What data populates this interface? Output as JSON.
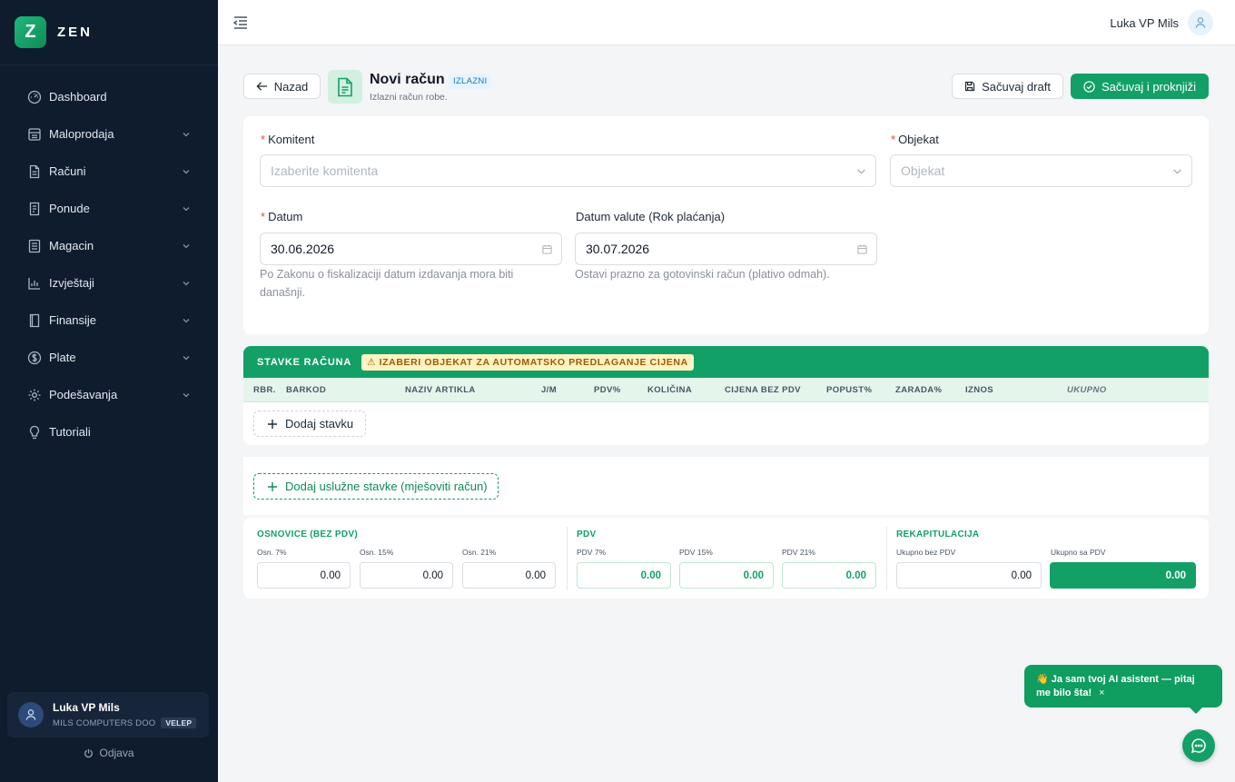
{
  "brand": {
    "logo_letter": "Z",
    "name": "ZEN",
    "accent": "#12a067",
    "sidebar_bg": "#0f1c2e"
  },
  "sidebar": {
    "items": [
      {
        "label": "Dashboard",
        "icon": "dashboard-icon",
        "expandable": false
      },
      {
        "label": "Maloprodaja",
        "icon": "register-icon",
        "expandable": true
      },
      {
        "label": "Računi",
        "icon": "document-icon",
        "expandable": true
      },
      {
        "label": "Ponude",
        "icon": "offer-icon",
        "expandable": true
      },
      {
        "label": "Magacin",
        "icon": "warehouse-icon",
        "expandable": true
      },
      {
        "label": "Izvještaji",
        "icon": "chart-icon",
        "expandable": true
      },
      {
        "label": "Finansije",
        "icon": "book-icon",
        "expandable": true
      },
      {
        "label": "Plate",
        "icon": "dollar-icon",
        "expandable": true
      },
      {
        "label": "Podešavanja",
        "icon": "gear-icon",
        "expandable": true
      },
      {
        "label": "Tutoriali",
        "icon": "bulb-icon",
        "expandable": false
      }
    ],
    "user": {
      "name": "Luka VP Mils",
      "company": "MILS COMPUTERS DOO",
      "role_badge": "VELEP"
    },
    "logout_label": "Odjava"
  },
  "topbar": {
    "user_name": "Luka VP Mils"
  },
  "header": {
    "back_label": "Nazad",
    "title": "Novi račun",
    "badge": "IZLAZNI",
    "subtitle": "Izlazni račun robe.",
    "save_draft_label": "Sačuvaj draft",
    "save_post_label": "Sačuvaj i proknjiži"
  },
  "form": {
    "komitent": {
      "label": "Komitent",
      "placeholder": "Izaberite komitenta",
      "required": true
    },
    "objekat": {
      "label": "Objekat",
      "placeholder": "Objekat",
      "required": true
    },
    "datum": {
      "label": "Datum",
      "value": "30.06.2026",
      "required": true,
      "help": "Po Zakonu o fiskalizaciji datum izdavanja mora biti današnji."
    },
    "datum_valute": {
      "label": "Datum valute (Rok plaćanja)",
      "value": "30.07.2026",
      "required": false,
      "help": "Ostavi prazno za gotovinski račun (plativo odmah)."
    }
  },
  "items": {
    "title": "STAVKE RAČUNA",
    "warning": "⚠ IZABERI OBJEKAT ZA AUTOMATSKO PREDLAGANJE CIJENA",
    "columns": [
      "RBR.",
      "BARKOD",
      "NAZIV ARTIKLA",
      "J/M",
      "PDV%",
      "KOLIČINA",
      "CIJENA BEZ PDV",
      "POPUST%",
      "ZARADA%",
      "IZNOS",
      "UKUPNO"
    ],
    "add_item_label": "Dodaj stavku",
    "add_service_label": "Dodaj uslužne stavke (mješoviti račun)"
  },
  "totals": {
    "osnovice": {
      "title": "OSNOVICE (BEZ PDV)",
      "fields": [
        {
          "label": "Osn. 7%",
          "value": "0.00"
        },
        {
          "label": "Osn. 15%",
          "value": "0.00"
        },
        {
          "label": "Osn. 21%",
          "value": "0.00"
        }
      ]
    },
    "pdv": {
      "title": "PDV",
      "fields": [
        {
          "label": "PDV 7%",
          "value": "0.00"
        },
        {
          "label": "PDV 15%",
          "value": "0.00"
        },
        {
          "label": "PDV 21%",
          "value": "0.00"
        }
      ]
    },
    "rekap": {
      "title": "REKAPITULACIJA",
      "fields": [
        {
          "label": "Ukupno bez PDV",
          "value": "0.00"
        },
        {
          "label": "Ukupno sa PDV",
          "value": "0.00"
        }
      ]
    }
  },
  "chat": {
    "message": "👋 Ja sam tvoj AI asistent — pitaj me bilo šta!",
    "close": "×"
  }
}
